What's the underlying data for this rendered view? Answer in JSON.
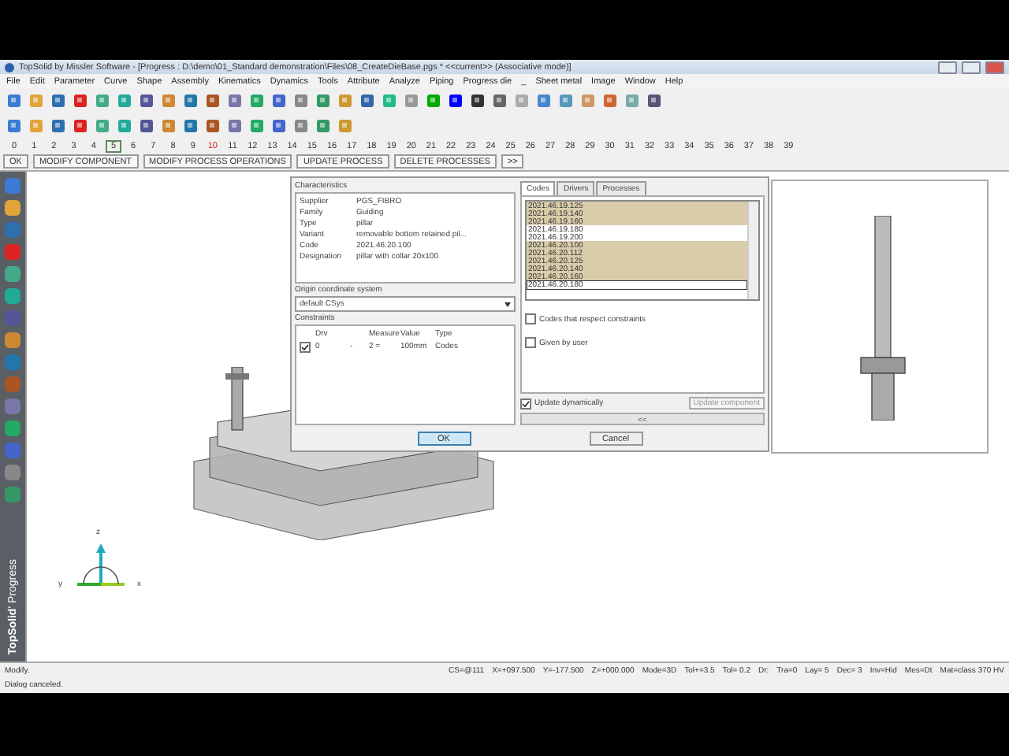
{
  "window": {
    "title": "TopSolid by Missler Software - [Progress : D:\\demo\\01_Standard demonstration\\Files\\08_CreateDieBase.pgs * <<current>> (Associative mode)]"
  },
  "menu": [
    "File",
    "Edit",
    "Parameter",
    "Curve",
    "Shape",
    "Assembly",
    "Kinematics",
    "Dynamics",
    "Tools",
    "Attribute",
    "Analyze",
    "Piping",
    "Progress die",
    "_",
    "Sheet metal",
    "Image",
    "Window",
    "Help"
  ],
  "layers": [
    {
      "label": "0",
      "selected": false,
      "marked": false
    },
    {
      "label": "1",
      "selected": false,
      "marked": false
    },
    {
      "label": "2",
      "selected": false,
      "marked": false
    },
    {
      "label": "3",
      "selected": false,
      "marked": false
    },
    {
      "label": "4",
      "selected": false,
      "marked": false
    },
    {
      "label": "5",
      "selected": true,
      "marked": false
    },
    {
      "label": "6",
      "selected": false,
      "marked": false
    },
    {
      "label": "7",
      "selected": false,
      "marked": false
    },
    {
      "label": "8",
      "selected": false,
      "marked": false
    },
    {
      "label": "9",
      "selected": false,
      "marked": false
    },
    {
      "label": "10",
      "selected": false,
      "marked": true
    },
    {
      "label": "11",
      "selected": false,
      "marked": false
    },
    {
      "label": "12",
      "selected": false,
      "marked": false
    },
    {
      "label": "13",
      "selected": false,
      "marked": false
    },
    {
      "label": "14",
      "selected": false,
      "marked": false
    },
    {
      "label": "15",
      "selected": false,
      "marked": false
    },
    {
      "label": "16",
      "selected": false,
      "marked": false
    },
    {
      "label": "17",
      "selected": false,
      "marked": false
    },
    {
      "label": "18",
      "selected": false,
      "marked": false
    },
    {
      "label": "19",
      "selected": false,
      "marked": false
    },
    {
      "label": "20",
      "selected": false,
      "marked": false
    },
    {
      "label": "21",
      "selected": false,
      "marked": false
    },
    {
      "label": "22",
      "selected": false,
      "marked": false
    },
    {
      "label": "23",
      "selected": false,
      "marked": false
    },
    {
      "label": "24",
      "selected": false,
      "marked": false
    },
    {
      "label": "25",
      "selected": false,
      "marked": false
    },
    {
      "label": "26",
      "selected": false,
      "marked": false
    },
    {
      "label": "27",
      "selected": false,
      "marked": false
    },
    {
      "label": "28",
      "selected": false,
      "marked": false
    },
    {
      "label": "29",
      "selected": false,
      "marked": false
    },
    {
      "label": "30",
      "selected": false,
      "marked": false
    },
    {
      "label": "31",
      "selected": false,
      "marked": false
    },
    {
      "label": "32",
      "selected": false,
      "marked": false
    },
    {
      "label": "33",
      "selected": false,
      "marked": false
    },
    {
      "label": "34",
      "selected": false,
      "marked": false
    },
    {
      "label": "35",
      "selected": false,
      "marked": false
    },
    {
      "label": "36",
      "selected": false,
      "marked": false
    },
    {
      "label": "37",
      "selected": false,
      "marked": false
    },
    {
      "label": "38",
      "selected": false,
      "marked": false
    },
    {
      "label": "39",
      "selected": false,
      "marked": false
    }
  ],
  "commands": [
    "OK",
    "MODIFY COMPONENT",
    "MODIFY PROCESS OPERATIONS",
    "UPDATE PROCESS",
    "DELETE PROCESSES",
    ">>"
  ],
  "side_label": {
    "brand": "TopSolid",
    "product": "' Progress"
  },
  "axes": {
    "z": "z",
    "y": "y",
    "x": "x"
  },
  "dialog": {
    "characteristics": {
      "title": "Characteristics",
      "rows": [
        {
          "key": "Supplier",
          "value": "PGS_FIBRO"
        },
        {
          "key": "Family",
          "value": "Guiding"
        },
        {
          "key": "Type",
          "value": "pillar"
        },
        {
          "key": "Variant",
          "value": "removable bottom retained pil..."
        },
        {
          "key": "Code",
          "value": "2021.46.20.100"
        },
        {
          "key": "Designation",
          "value": "pillar with collar 20x100"
        }
      ]
    },
    "origin": {
      "label": "Origin coordinate system",
      "value": "default CSys"
    },
    "constraints": {
      "title": "Constraints",
      "columns": [
        "Drv",
        "Measure",
        "Value",
        "Type"
      ],
      "rows": [
        {
          "checked": true,
          "drv": "0",
          "op": "-",
          "measure": "2 =",
          "value": "100mm",
          "type": "Codes"
        }
      ]
    },
    "tabs": [
      {
        "label": "Codes",
        "selected": true
      },
      {
        "label": "Drivers",
        "selected": false
      },
      {
        "label": "Processes",
        "selected": false
      }
    ],
    "codes": [
      {
        "code": "2021.46.19.125",
        "highlighted": true,
        "selected": false
      },
      {
        "code": "2021.46.19.140",
        "highlighted": true,
        "selected": false
      },
      {
        "code": "2021.46.19.160",
        "highlighted": true,
        "selected": false
      },
      {
        "code": "2021.46.19.180",
        "highlighted": false,
        "selected": false
      },
      {
        "code": "2021.46.19.200",
        "highlighted": false,
        "selected": false
      },
      {
        "code": "2021.46.20.100",
        "highlighted": true,
        "selected": false
      },
      {
        "code": "2021.46.20.112",
        "highlighted": true,
        "selected": false
      },
      {
        "code": "2021.46.20.125",
        "highlighted": true,
        "selected": false
      },
      {
        "code": "2021.46.20.140",
        "highlighted": true,
        "selected": false
      },
      {
        "code": "2021.46.20.160",
        "highlighted": true,
        "selected": false
      },
      {
        "code": "2021.46.20.180",
        "highlighted": false,
        "selected": true
      }
    ],
    "options": [
      {
        "label": "Codes that respect constraints",
        "checked": false
      },
      {
        "label": "Given by user",
        "checked": false
      }
    ],
    "update_dynamically": {
      "label": "Update dynamically",
      "checked": true
    },
    "update_button": {
      "label": "Update component",
      "disabled": true
    },
    "expand_button": "<<",
    "ok": "OK",
    "cancel": "Cancel"
  },
  "status_bar": {
    "message": "Modify.",
    "fields": [
      "CS=@111",
      "X=+097.500",
      "Y=-177.500",
      "Z=+000.000",
      "Mode=3D",
      "Tol+=3.5",
      "Tol= 0.2",
      "Dr:",
      "Tra=0",
      "Lay= 5",
      "Dec= 3",
      "Inv=Hid",
      "Mes=Dt",
      "Mat=class 370 HV"
    ],
    "log": "Dialog canceled."
  }
}
